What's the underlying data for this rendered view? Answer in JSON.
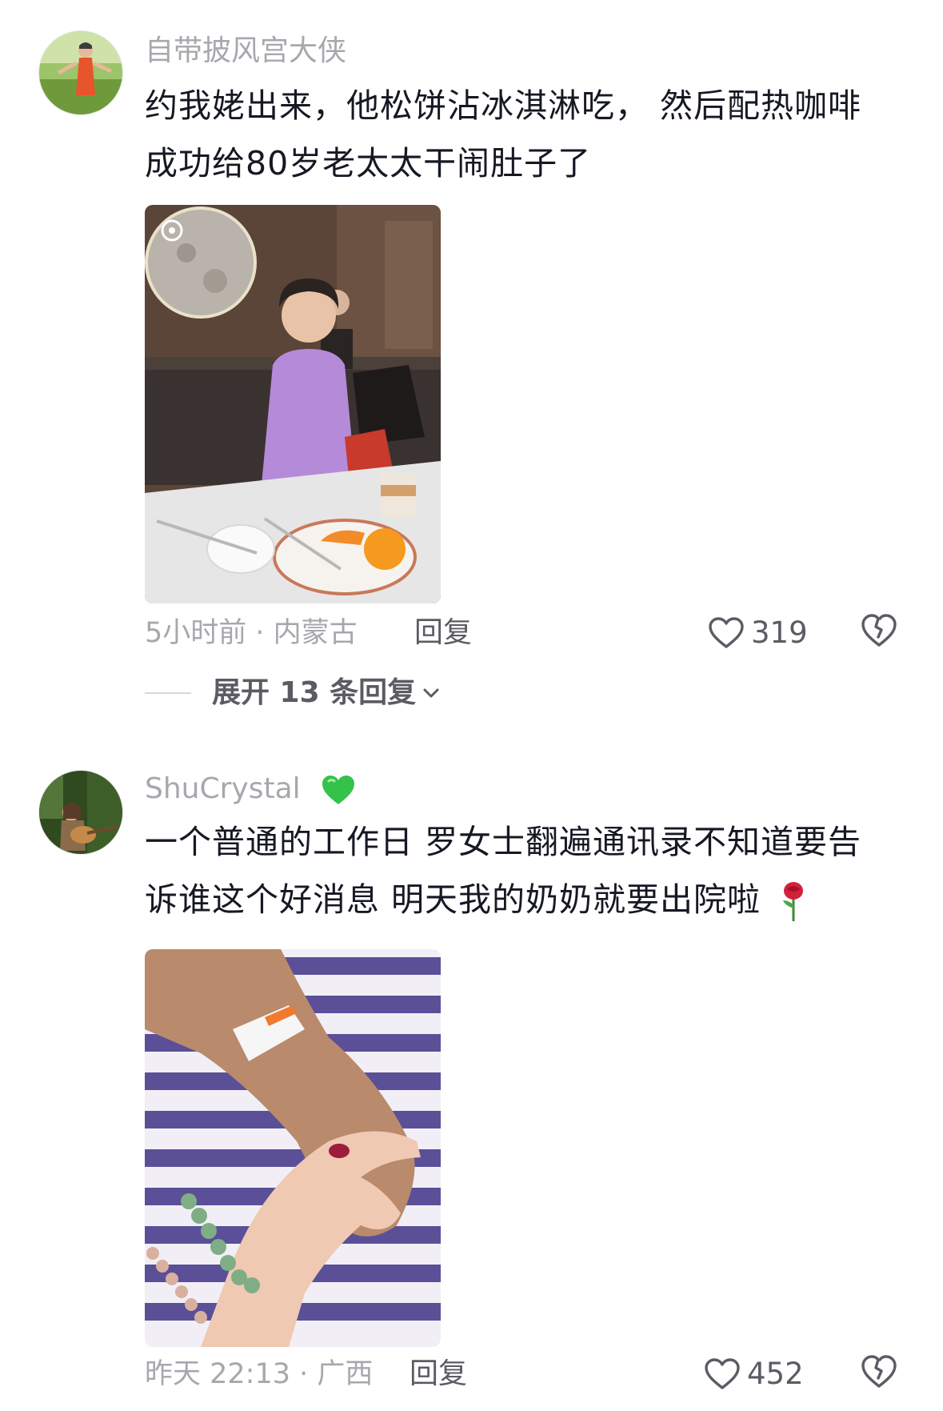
{
  "comments": [
    {
      "username": "自带披风宫大侠",
      "text_lines": [
        "约我姥出来，他松饼沾冰淇淋吃， 然后配热咖啡",
        "成功给80岁老太太干闹肚子了"
      ],
      "meta": "5小时前 · 内蒙古",
      "reply_label": "回复",
      "likes": "319",
      "expand_label": "展开 13 条回复",
      "avatar_icon": "avatar-woman-outdoors",
      "photo": "elderly-woman-restaurant-photo"
    },
    {
      "username": "ShuCrystal",
      "username_emoji": "green-heart-emoji",
      "text_lines": [
        "一个普通的工作日 罗女士翻遍通讯录不知道要告",
        "诉谁这个好消息 明天我的奶奶就要出院啦"
      ],
      "text_emoji": "rose-emoji",
      "meta": "昨天 22:13 · 广西",
      "reply_label": "回复",
      "likes": "452",
      "avatar_icon": "avatar-woman-guitar",
      "photo": "holding-hands-hospital-bracelet-photo"
    }
  ],
  "colors": {
    "text_primary": "#161823",
    "text_secondary": "#a7a8ad",
    "action_text": "#5b5c63"
  }
}
